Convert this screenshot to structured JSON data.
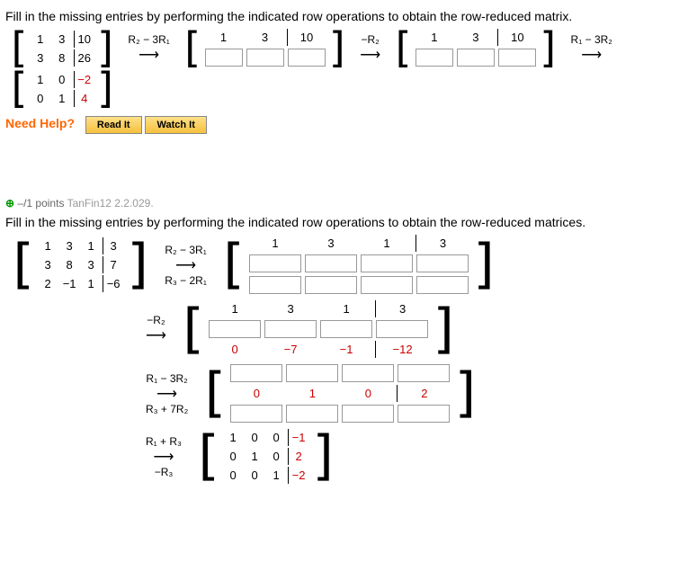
{
  "q1": {
    "instruct": "Fill in the missing entries by performing the indicated row operations to obtain the row-reduced matrix.",
    "m1": {
      "r1": [
        "1",
        "3",
        "10"
      ],
      "r2": [
        "3",
        "8",
        "26"
      ]
    },
    "op1": "R₂ − 3R₁",
    "m2top": [
      "1",
      "3",
      "10"
    ],
    "op2": "−R₂",
    "m3top": [
      "1",
      "3",
      "10"
    ],
    "op3": "R₁ − 3R₂",
    "m4": {
      "r1": [
        "1",
        "0",
        "−2"
      ],
      "r2": [
        "0",
        "1",
        "4"
      ]
    },
    "help": "Need Help?",
    "readit": "Read It",
    "watchit": "Watch It"
  },
  "q2": {
    "points": "–/1 points",
    "ref": "TanFin12 2.2.029.",
    "instruct": "Fill in the missing entries by performing the indicated row operations to obtain the row-reduced matrices.",
    "m1": {
      "r1": [
        "1",
        "3",
        "1",
        "3"
      ],
      "r2": [
        "3",
        "8",
        "3",
        "7"
      ],
      "r3": [
        "2",
        "−1",
        "1",
        "−6"
      ]
    },
    "op1a": "R₂ − 3R₁",
    "op1b": "R₃ − 2R₁",
    "s1top": [
      "1",
      "3",
      "1",
      "3"
    ],
    "op2": "−R₂",
    "s2top": [
      "1",
      "3",
      "1",
      "3"
    ],
    "s2r3": [
      "0",
      "−7",
      "−1",
      "−12"
    ],
    "op3a": "R₁ − 3R₂",
    "op3b": "R₃ + 7R₂",
    "s3r2": [
      "0",
      "1",
      "0",
      "2"
    ],
    "op4a": "R₁ + R₃",
    "op4b": "−R₃",
    "mf": {
      "r1": [
        "1",
        "0",
        "0",
        "−1"
      ],
      "r2": [
        "0",
        "1",
        "0",
        "2"
      ],
      "r3": [
        "0",
        "0",
        "1",
        "−2"
      ]
    }
  },
  "chart_data": null
}
